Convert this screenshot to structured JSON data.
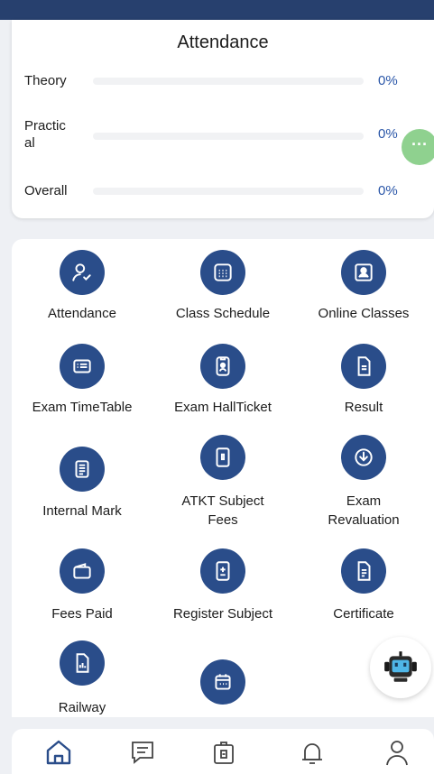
{
  "attendance": {
    "title": "Attendance",
    "rows": [
      {
        "label": "Theory",
        "value": "0%",
        "fraction": 0
      },
      {
        "label": "Practic\nal",
        "value": "0%",
        "fraction": 0
      },
      {
        "label": "Overall",
        "value": "0%",
        "fraction": 0
      }
    ]
  },
  "menu": {
    "items": [
      {
        "label": "Attendance",
        "icon": "user-check-icon"
      },
      {
        "label": "Class Schedule",
        "icon": "calendar-grid-icon"
      },
      {
        "label": "Online Classes",
        "icon": "video-person-icon"
      },
      {
        "label": "Exam TimeTable",
        "icon": "list-icon"
      },
      {
        "label": "Exam HallTicket",
        "icon": "id-badge-icon"
      },
      {
        "label": "Result",
        "icon": "document-icon"
      },
      {
        "label": "Internal Mark",
        "icon": "notes-icon"
      },
      {
        "label": "ATKT Subject Fees",
        "icon": "tablet-icon"
      },
      {
        "label": "Exam Revaluation",
        "icon": "download-circle-icon"
      },
      {
        "label": "Fees Paid",
        "icon": "wallet-icon"
      },
      {
        "label": "Register Subject",
        "icon": "plus-minus-document-icon"
      },
      {
        "label": "Certificate",
        "icon": "certificate-icon"
      },
      {
        "label": "Railway",
        "icon": "document-chart-icon"
      },
      {
        "label": "",
        "icon": "calendar-icon"
      }
    ]
  },
  "bottom_nav": {
    "items": [
      {
        "icon": "home-icon"
      },
      {
        "icon": "message-icon"
      },
      {
        "icon": "id-card-icon"
      },
      {
        "icon": "bell-icon"
      },
      {
        "icon": "profile-icon"
      }
    ]
  },
  "colors": {
    "header": "#27406e",
    "icon_bg": "#2a4d8a",
    "value_text": "#2a56a8",
    "fab_green": "#8fd18f"
  }
}
